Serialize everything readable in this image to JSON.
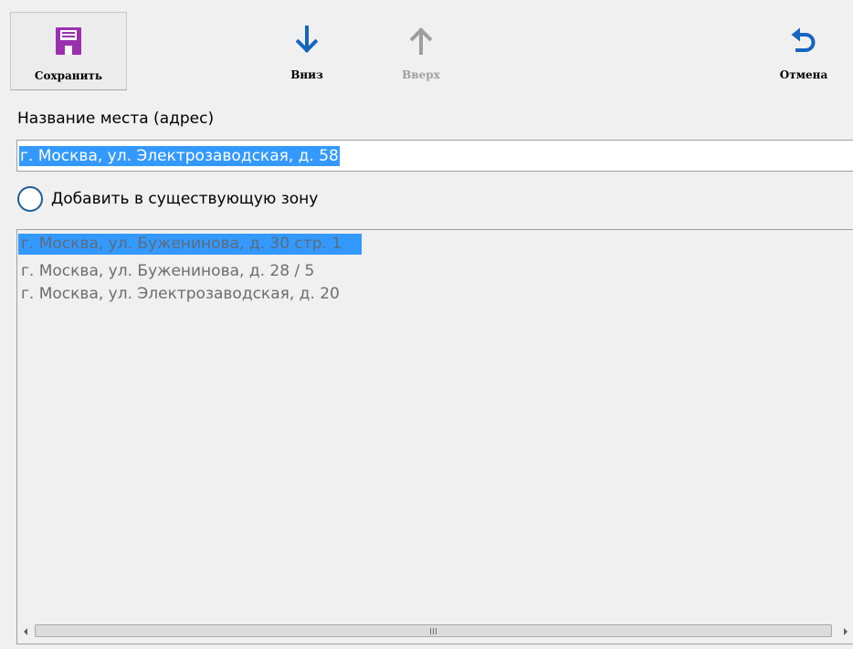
{
  "toolbar": {
    "save_label": "Сохранить",
    "down_label": "Вниз",
    "up_label": "Вверх",
    "cancel_label": "Отмена",
    "save_icon": "floppy-disk-icon",
    "down_icon": "arrow-down-icon",
    "up_icon": "arrow-up-icon",
    "cancel_icon": "undo-arrow-icon",
    "up_enabled": false
  },
  "place": {
    "label": "Название места (адрес)",
    "value": "г. Москва, ул. Электрозаводская, д. 58"
  },
  "zone_option": {
    "label": "Добавить в существующую зону",
    "checked": false
  },
  "zone_list": {
    "items": [
      "г. Москва, ул. Буженинова, д. 30 стр. 1",
      "г. Москва, ул. Буженинова, д. 28 / 5",
      "г. Москва, ул. Электрозаводская, д. 20"
    ],
    "selected_index": 0
  },
  "colors": {
    "save_icon": "#9b2fae",
    "arrow_active": "#1565c0",
    "arrow_disabled": "#9e9e9e",
    "selection": "#3399ff",
    "radio_border": "#1d5e96",
    "background": "#f0f0f0"
  }
}
